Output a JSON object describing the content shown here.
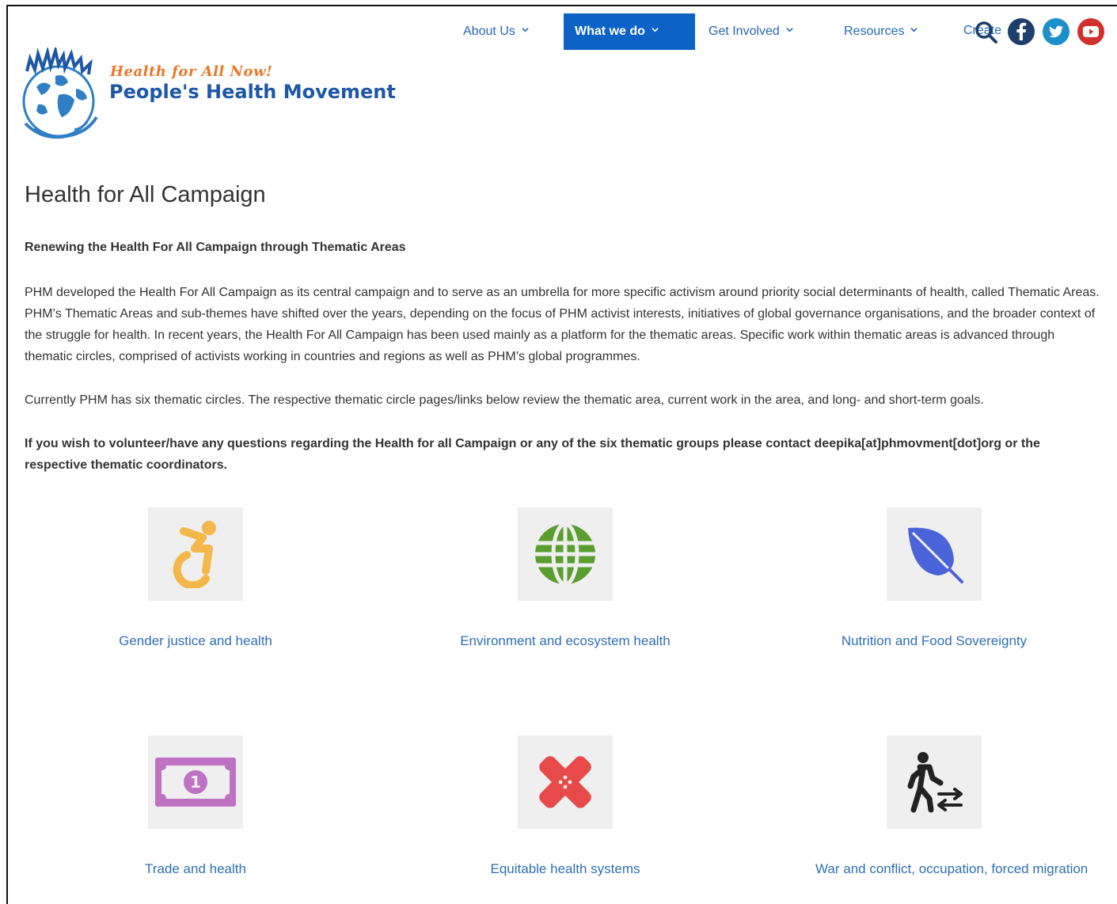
{
  "header": {
    "tagline": "Health for All Now!",
    "site_name": "People's Health Movement"
  },
  "nav": {
    "items": [
      {
        "label": "About Us"
      },
      {
        "label": "What we do",
        "active": true
      },
      {
        "label": "Get Involved"
      },
      {
        "label": "Resources"
      }
    ],
    "create_label": "Create"
  },
  "social": {
    "facebook_color": "#1d3f6e",
    "twitter_color": "#1a8fc9",
    "youtube_color": "#d0312d"
  },
  "main": {
    "title": "Health for All Campaign",
    "subheading": "Renewing the Health For All Campaign through Thematic Areas",
    "paragraph1": "PHM developed the Health For All Campaign as its central campaign and to serve as an umbrella for more specific activism around priority social determinants of health, called Thematic Areas. PHM’s Thematic Areas and sub-themes have shifted over the years, depending on the focus of PHM activist interests, initiatives of global governance organisations, and the broader context of the struggle for health. In recent years, the Health For All Campaign has been used mainly as a platform for the thematic areas. Specific work within thematic areas is advanced through thematic circles, comprised of activists working in countries and regions as well as PHM’s global programmes.",
    "paragraph2": "Currently PHM has six thematic circles. The respective thematic circle pages/links below review the thematic area, current work in the area, and long- and short-term goals.",
    "paragraph3": "If you wish to volunteer/have any questions regarding the Health for all Campaign or any of the six thematic groups please contact deepika[at]phmovment[dot]org or the respective thematic coordinators."
  },
  "themes": [
    {
      "label": "Gender justice and health",
      "icon": "accessibility-icon",
      "color": "#f5b64a"
    },
    {
      "label": "Environment and ecosystem health",
      "icon": "globe-icon",
      "color": "#5a9e2f"
    },
    {
      "label": "Nutrition and Food Sovereignty",
      "icon": "leaf-icon",
      "color": "#4a63d8"
    },
    {
      "label": "Trade and health",
      "icon": "money-icon",
      "color": "#bf72c4"
    },
    {
      "label": "Equitable health systems",
      "icon": "bandage-icon",
      "color": "#e84a4a"
    },
    {
      "label": "War and conflict, occupation, forced migration",
      "icon": "migration-icon",
      "color": "#222222"
    }
  ]
}
